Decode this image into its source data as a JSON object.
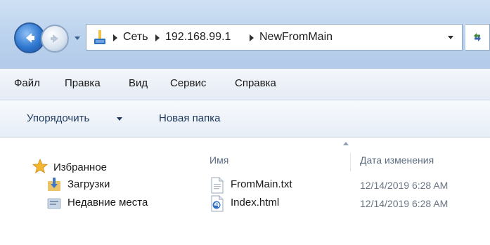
{
  "address": {
    "breadcrumbs": [
      "Сеть",
      "192.168.99.1",
      "NewFromMain"
    ]
  },
  "menu": {
    "items": [
      "Файл",
      "Правка",
      "Вид",
      "Сервис",
      "Справка"
    ]
  },
  "commands": {
    "organize": "Упорядочить",
    "new_folder": "Новая папка"
  },
  "nav_pane": {
    "items": [
      "Избранное",
      "Загрузки",
      "Недавние места"
    ]
  },
  "columns": {
    "name": "Имя",
    "date_modified": "Дата изменения"
  },
  "files": [
    {
      "name": "FromMain.txt",
      "date": "12/14/2019 6:28 AM",
      "icon": "text-file-icon"
    },
    {
      "name": "Index.html",
      "date": "12/14/2019 6:28 AM",
      "icon": "html-file-icon"
    }
  ],
  "colors": {
    "chrome_blue": "#bcd3ee",
    "back_button": "#2f78d0",
    "command_text": "#1e395b"
  }
}
